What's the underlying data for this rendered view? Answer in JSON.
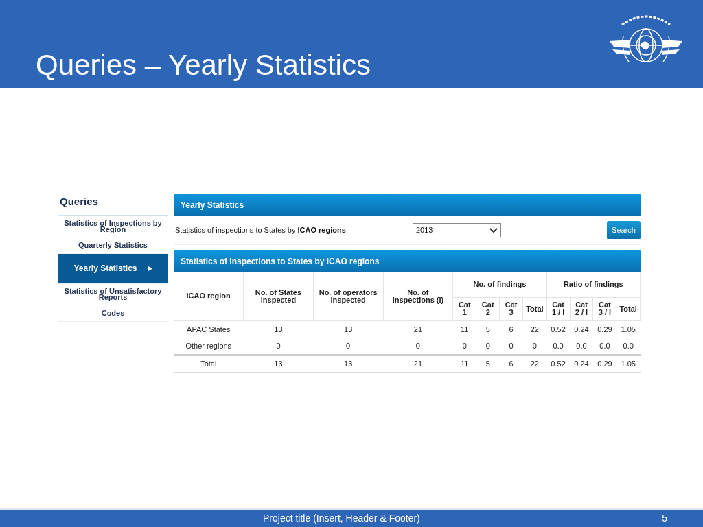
{
  "slide": {
    "title": "Queries – Yearly Statistics",
    "footer": "Project title (Insert, Header & Footer)",
    "page_number": "5"
  },
  "sidebar": {
    "title": "Queries",
    "items": [
      {
        "label": "Statistics of Inspections by Region",
        "selected": false
      },
      {
        "label": "Quarterly Statistics",
        "selected": false
      },
      {
        "label": "Yearly Statistics",
        "selected": true
      },
      {
        "label": "Statistics of Unsatisfactory Reports",
        "selected": false
      },
      {
        "label": "Codes",
        "selected": false
      }
    ]
  },
  "filter_panel": {
    "title": "Yearly Statistics",
    "label": "Statistics of inspections to States by **ICAO regions**",
    "year": "2013",
    "search_button": "Search"
  },
  "results_panel": {
    "title": "Statistics of inspections to States by ICAO regions",
    "table": {
      "columns": [
        "ICAO region",
        "No. of States inspected",
        "No. of operators inspected",
        "No. of inspections (I)"
      ],
      "groups": [
        {
          "label": "No. of findings",
          "columns": [
            "Cat 1",
            "Cat 2",
            "Cat 3",
            "Total"
          ]
        },
        {
          "label": "Ratio of findings",
          "columns": [
            "Cat 1 / I",
            "Cat 2 / I",
            "Cat 3 / I",
            "Total"
          ]
        }
      ],
      "rows": [
        [
          "APAC States",
          "13",
          "13",
          "21",
          "11",
          "5",
          "6",
          "22",
          "0.52",
          "0.24",
          "0.29",
          "1.05"
        ],
        [
          "Other regions",
          "0",
          "0",
          "0",
          "0",
          "0",
          "0",
          "0",
          "0.0",
          "0.0",
          "0.0",
          "0.0"
        ]
      ],
      "total_row": [
        "Total",
        "13",
        "13",
        "21",
        "11",
        "5",
        "6",
        "22",
        "0.52",
        "0.24",
        "0.29",
        "1.05"
      ]
    }
  }
}
